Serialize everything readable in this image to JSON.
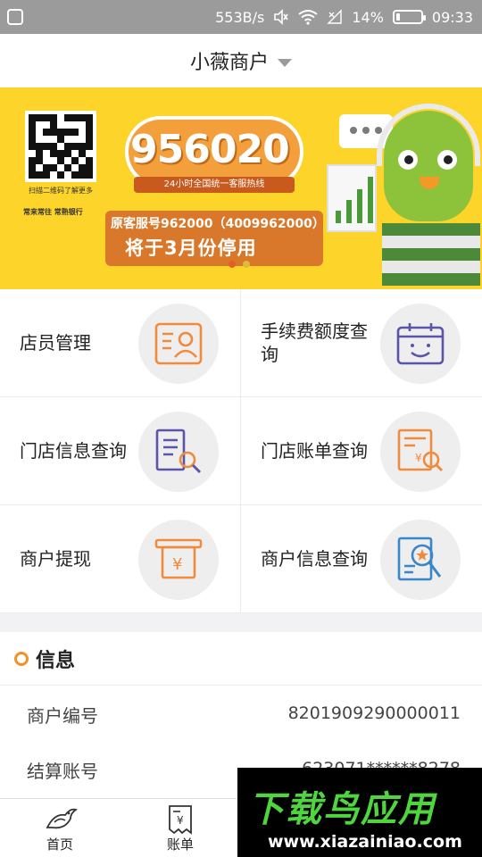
{
  "status_bar": {
    "speed": "553B/s",
    "battery_percent": "14%",
    "battery_level": 0.14,
    "time": "09:33"
  },
  "header": {
    "title": "小薇商户"
  },
  "banner": {
    "qr_caption": "扫描二维码了解更多",
    "bank_text": "常来常往 常熟银行",
    "hotline_number": "956020",
    "hotline_sub": "24小时全国统一客服热线",
    "notice_line1": "原客服号962000（4009962000）",
    "notice_line2": "将于3月份停用",
    "active_slide": 1,
    "slide_count": 2
  },
  "menu": [
    {
      "label": "店员管理",
      "icon": "staff-card-icon",
      "color": "#f08a3c"
    },
    {
      "label": "手续费额度查询",
      "icon": "calendar-smile-icon",
      "color": "#5a55a8"
    },
    {
      "label": "门店信息查询",
      "icon": "document-search-icon",
      "color": "#5a55a8"
    },
    {
      "label": "门店账单查询",
      "icon": "bill-search-icon",
      "color": "#f08a3c"
    },
    {
      "label": "商户提现",
      "icon": "yuan-withdraw-icon",
      "color": "#f08a3c"
    },
    {
      "label": "商户信息查询",
      "icon": "star-doc-search-icon",
      "color": "#3a86c8"
    }
  ],
  "info": {
    "title": "信息",
    "rows": [
      {
        "key": "商户编号",
        "value": "8201909290000011"
      },
      {
        "key": "结算账号",
        "value": "623071******8278"
      }
    ]
  },
  "tabs": [
    {
      "label": "首页",
      "icon": "home-bird-icon"
    },
    {
      "label": "账单",
      "icon": "bill-icon"
    }
  ],
  "watermark": {
    "title": "下载鸟应用",
    "url": "www.xiazainiao.com"
  },
  "colors": {
    "accent": "#f0922a",
    "banner_bg": "#fdd42a",
    "watermark_green": "#4fd63f"
  }
}
